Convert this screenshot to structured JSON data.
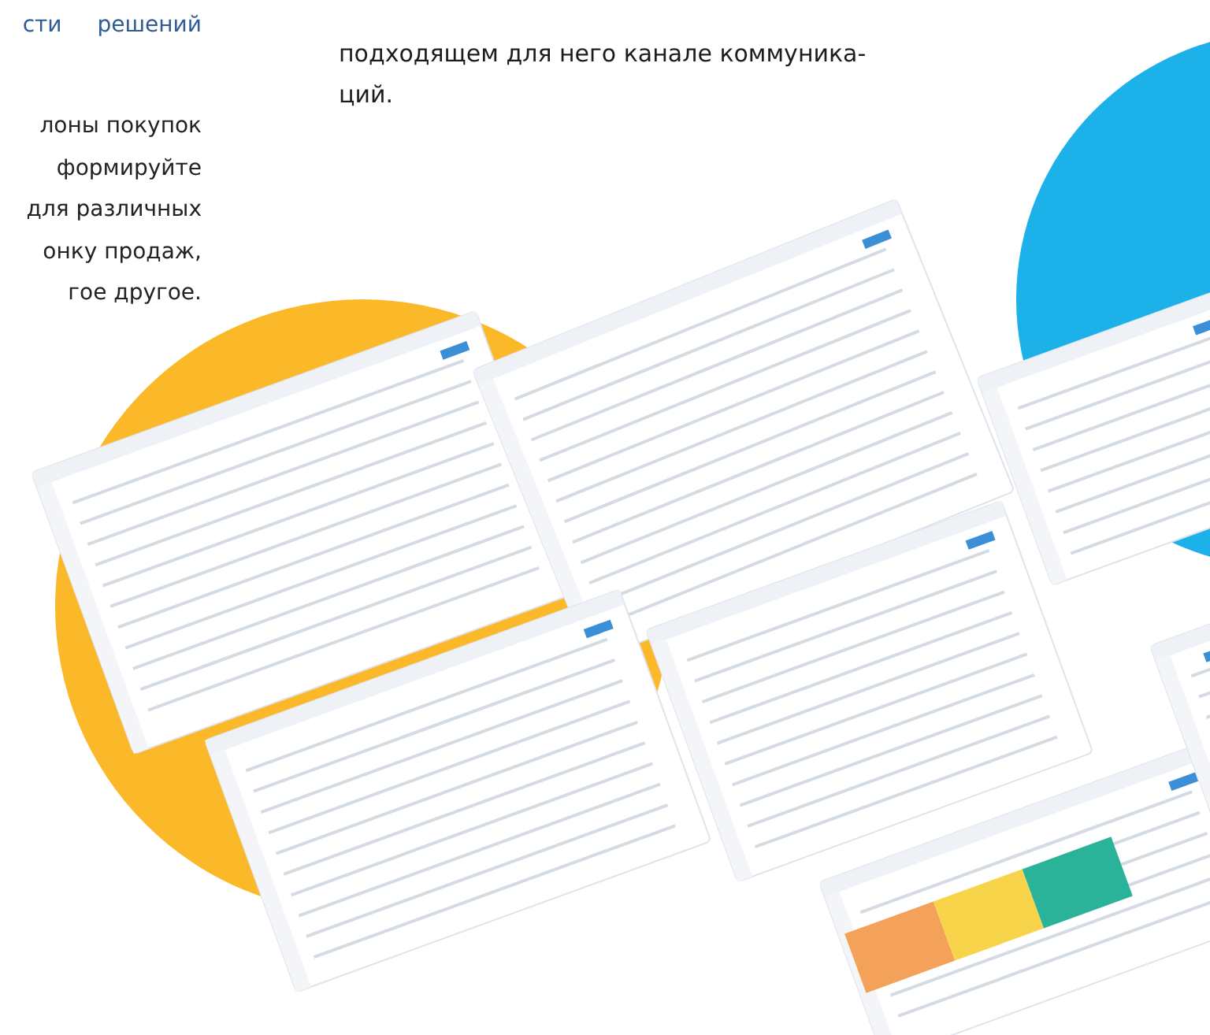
{
  "left_column": {
    "heading": "сти решений",
    "lines": [
      "лоны покупок",
      "формируйте",
      "для различных",
      "онку продаж,",
      "гое другое."
    ]
  },
  "middle_column": {
    "lines": [
      "подходящем для него канале коммуника-",
      "ций."
    ]
  }
}
